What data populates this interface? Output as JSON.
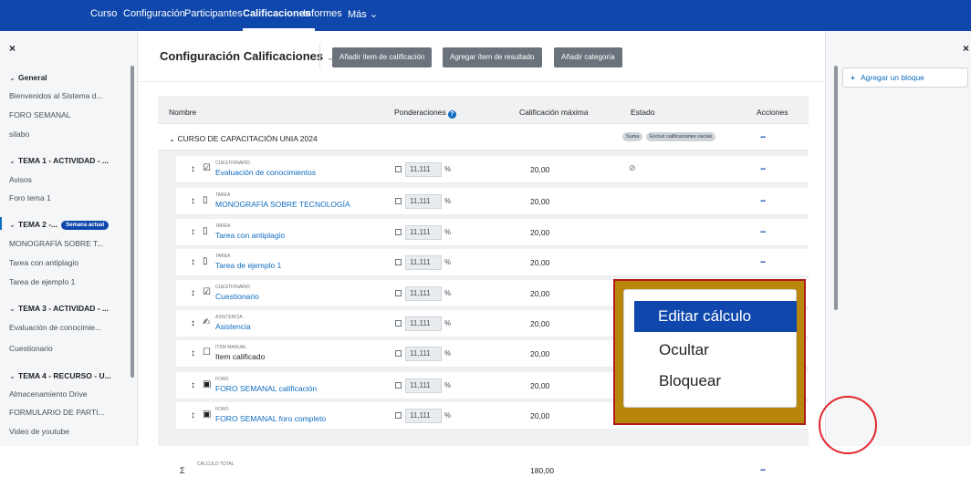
{
  "topnav": {
    "items": [
      "Curso",
      "Configuración",
      "Participantes",
      "Calificaciones",
      "Informes",
      "Más ⌄"
    ],
    "active": "Calificaciones"
  },
  "course_index": {
    "close": "×",
    "sections": [
      {
        "title": "General",
        "items": [
          "Bienvenidos al Sistema d...",
          "FORO SEMANAL",
          "silabo"
        ]
      },
      {
        "title": "TEMA 1 - ACTIVIDAD - ...",
        "items": [
          "Avisos",
          "Foro tema 1"
        ]
      },
      {
        "title": "TEMA 2 -...",
        "badge": "Semana actual",
        "items": [
          "MONOGRAFÍA SOBRE T...",
          "Tarea con antiplagio",
          "Tarea de ejemplo 1"
        ]
      },
      {
        "title": "TEMA 3 - ACTIVIDAD - ...",
        "items": [
          "Evaluación de conocimie...",
          "Cuestionario"
        ]
      },
      {
        "title": "TEMA 4 - RECURSO - U...",
        "items": [
          "Almacenamiento Drive",
          "FORMULARIO DE PARTI...",
          "Video de youtube"
        ]
      }
    ]
  },
  "header": {
    "title": "Configuración Calificaciones",
    "caret": "⌄",
    "buttons": [
      "Añadir ítem de calificación",
      "Agregar ítem de resultado",
      "Añadir categoría"
    ]
  },
  "table": {
    "columns": {
      "name": "Nombre",
      "weights": "Ponderaciones",
      "help": "?",
      "max": "Calificación máxima",
      "status": "Estado",
      "actions": "Acciones"
    },
    "category": {
      "name": "CURSO DE CAPACITACIÓN UNIA 2024",
      "pills": [
        "Suma",
        "Excluir calificaciones vacías"
      ],
      "actions": "..."
    },
    "items": [
      {
        "type": "CUESTIONARIO",
        "name": "Evaluación de conocimientos",
        "icon": "quiz-icon",
        "weight": "11,111",
        "max": "20,00",
        "hidden": true
      },
      {
        "type": "TAREA",
        "name": "MONOGRAFÍA SOBRE TECNOLOGÍA",
        "icon": "assignment-icon",
        "weight": "11,111",
        "max": "20,00",
        "hidden": false
      },
      {
        "type": "TAREA",
        "name": "Tarea con antiplagio",
        "icon": "assignment-icon",
        "weight": "11,111",
        "max": "20,00",
        "hidden": false
      },
      {
        "type": "TAREA",
        "name": "Tarea de ejemplo 1",
        "icon": "assignment-icon",
        "weight": "11,111",
        "max": "20,00",
        "hidden": false
      },
      {
        "type": "CUESTIONARIO",
        "name": "Cuestionario",
        "icon": "quiz-icon",
        "weight": "11,111",
        "max": "20,00",
        "hidden": false
      },
      {
        "type": "ASISTENCIA",
        "name": "Asistencia",
        "icon": "attendance-icon",
        "weight": "11,111",
        "max": "20,00",
        "hidden": false
      },
      {
        "type": "ÍTEM MANUAL",
        "name": "Item calificado",
        "icon": "manual-item-icon",
        "weight": "11,111",
        "max": "20,00",
        "hidden": false,
        "plain": true
      },
      {
        "type": "FORO",
        "name": "FORO SEMANAL calificación",
        "icon": "forum-icon",
        "weight": "11,111",
        "max": "20,00",
        "hidden": false
      },
      {
        "type": "FORO",
        "name": "FORO SEMANAL foro completo",
        "icon": "forum-icon",
        "weight": "11,111",
        "max": "20,00",
        "hidden": false
      }
    ],
    "percent": "%",
    "actions": "...",
    "total": {
      "type": "CÁLCULO TOTAL",
      "max": "180,00",
      "actions": "..."
    }
  },
  "context_menu": [
    "Editar cálculo",
    "Ocultar",
    "Bloquear"
  ],
  "right_drawer": {
    "close": "×",
    "add_block": "Agregar un bloque",
    "plus": "+"
  },
  "colors": {
    "primary": "#0f47ad",
    "link": "#0f6cbf",
    "highlight": "#b8860b",
    "cursor": "#e0262c"
  }
}
